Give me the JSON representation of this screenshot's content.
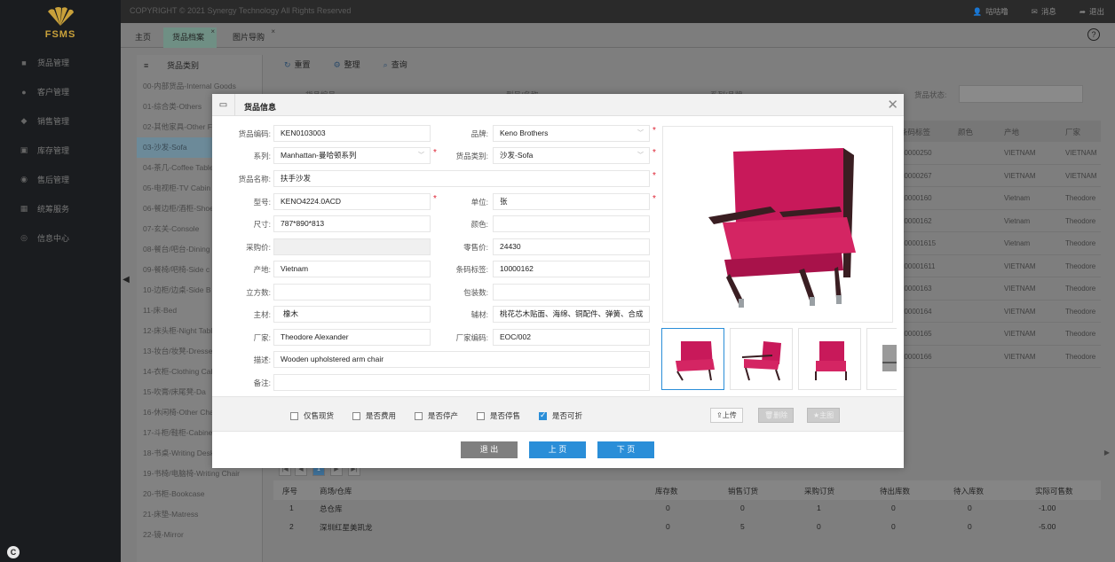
{
  "brand": {
    "logo_text": "FSMS"
  },
  "topbar": {
    "copyright": "COPYRIGHT © 2021 Synergy Technology All Rights Reserved",
    "user": "咕咕噜",
    "messages": "消息",
    "logout": "退出"
  },
  "sidebar": {
    "items": [
      {
        "label": "货品管理",
        "icon": "box-icon"
      },
      {
        "label": "客户管理",
        "icon": "users-icon"
      },
      {
        "label": "销售管理",
        "icon": "cart-icon"
      },
      {
        "label": "库存管理",
        "icon": "warehouse-icon"
      },
      {
        "label": "售后管理",
        "icon": "service-icon"
      },
      {
        "label": "统筹服务",
        "icon": "grid-icon"
      },
      {
        "label": "信息中心",
        "icon": "info-icon"
      }
    ],
    "footer_badge": "C"
  },
  "tabs": [
    {
      "label": "主页"
    },
    {
      "label": "货品档案"
    },
    {
      "label": "图片导购"
    }
  ],
  "category_panel": {
    "title": "货品类别",
    "items": [
      "00-内部货品-Internal Goods",
      "01-综合类-Others",
      "02-其他家具-Other F",
      "03-沙发-Sofa",
      "04-茶几-Coffee Table",
      "05-电视柜-TV Cabin",
      "06-餐边柜/酒柜-Shoe",
      "07-玄关-Console",
      "08-餐台/吧台-Dining",
      "09-餐椅/吧椅-Side c",
      "10-边柜/边桌-Side B",
      "11-床-Bed",
      "12-床头柜-Night Table",
      "13-妆台/妆凳-Dresse",
      "14-衣柜-Clothing Cab",
      "15-吹膏/床尾凳-Da",
      "16-休闲椅-Other Cha",
      "17-斗柜/鞋柜-Cabine",
      "18-书桌-Writing Desk",
      "19-书椅/电脑椅-Writing Chair",
      "20-书柜-Bookcase",
      "21-床垫-Matress",
      "22-镜-Mirror"
    ],
    "selected_index": 3
  },
  "toolbar": {
    "refresh": "重置",
    "organize": "整理",
    "query": "查询"
  },
  "filters": {
    "f1": "货品编号",
    "f2": "型号/名称",
    "f3": "系列/品牌",
    "status": "货品状态:"
  },
  "grid": {
    "headers": {
      "barcode": "条码标签",
      "color": "颜色",
      "origin": "产地",
      "maker": "厂家"
    },
    "rows": [
      {
        "barcode": "10000250",
        "origin": "VIETNAM",
        "maker": "VIETNAM"
      },
      {
        "barcode": "10000267",
        "origin": "VIETNAM",
        "maker": "VIETNAM"
      },
      {
        "barcode": "10000160",
        "origin": "Vietnam",
        "maker": "Theodore"
      },
      {
        "barcode": "10000162",
        "origin": "Vietnam",
        "maker": "Theodore"
      },
      {
        "barcode": "100001615",
        "origin": "Vietnam",
        "maker": "Theodore"
      },
      {
        "barcode": "100001611",
        "origin": "VIETNAM",
        "maker": "Theodore"
      },
      {
        "barcode": "10000163",
        "origin": "VIETNAM",
        "maker": "Theodore"
      },
      {
        "barcode": "10000164",
        "origin": "VIETNAM",
        "maker": "Theodore"
      },
      {
        "barcode": "10000165",
        "origin": "VIETNAM",
        "maker": "Theodore"
      },
      {
        "barcode": "10000166",
        "origin": "VIETNAM",
        "maker": "Theodore"
      }
    ]
  },
  "pager": {
    "current": "1"
  },
  "inventory": {
    "headers": {
      "no": "序号",
      "store": "商场/仓库",
      "stock": "库存数",
      "sales_order": "销售订货",
      "purchase_order": "采购订货",
      "shipping": "待出库数",
      "receiving": "待入库数",
      "available": "实际可售数"
    },
    "rows": [
      {
        "no": "1",
        "store": "总仓库",
        "stock": "0",
        "sales_order": "0",
        "purchase_order": "1",
        "shipping": "0",
        "receiving": "0",
        "available": "-1.00"
      },
      {
        "no": "2",
        "store": "深圳红星美凯龙",
        "stock": "0",
        "sales_order": "5",
        "purchase_order": "0",
        "shipping": "0",
        "receiving": "0",
        "available": "-5.00"
      }
    ]
  },
  "modal": {
    "title": "货品信息",
    "fields": {
      "code": {
        "label": "货品编码:",
        "value": "KEN0103003"
      },
      "brand": {
        "label": "品牌:",
        "value": "Keno Brothers"
      },
      "series": {
        "label": "系列:",
        "value": "Manhattan-曼哈顿系列"
      },
      "category": {
        "label": "货品类别:",
        "value": "沙发-Sofa"
      },
      "name": {
        "label": "货品名称:",
        "value": "扶手沙发"
      },
      "model": {
        "label": "型号:",
        "value": "KENO4224.0ACD"
      },
      "unit": {
        "label": "单位:",
        "value": "张"
      },
      "size": {
        "label": "尺寸:",
        "value": "787*890*813"
      },
      "color": {
        "label": "颜色:",
        "value": ""
      },
      "purchase_price": {
        "label": "采购价:",
        "value": ""
      },
      "retail_price": {
        "label": "零售价:",
        "value": "24430"
      },
      "origin": {
        "label": "产地:",
        "value": "Vietnam"
      },
      "barcode": {
        "label": "条码标签:",
        "value": "10000162"
      },
      "cubic": {
        "label": "立方数:",
        "value": ""
      },
      "packages": {
        "label": "包装数:",
        "value": ""
      },
      "main_material": {
        "label": "主材:",
        "value": "橡木"
      },
      "aux_material": {
        "label": "辅材:",
        "value": "桃花芯木贴面、海绵、铜配件、弹簧、合成"
      },
      "maker": {
        "label": "厂家:",
        "value": "Theodore Alexander"
      },
      "maker_code": {
        "label": "厂家编码:",
        "value": "EOC/002"
      },
      "desc": {
        "label": "描述:",
        "value": "Wooden upholstered arm chair"
      },
      "remark": {
        "label": "备注:",
        "value": ""
      }
    },
    "checkboxes": [
      {
        "label": "仅售现货",
        "checked": false
      },
      {
        "label": "是否费用",
        "checked": false
      },
      {
        "label": "是否停产",
        "checked": false
      },
      {
        "label": "是否停售",
        "checked": false
      },
      {
        "label": "是否可折",
        "checked": true
      }
    ],
    "image_buttons": {
      "upload": "上传",
      "delete": "删除",
      "primary": "主图"
    },
    "nav_buttons": {
      "exit": "退 出",
      "prev": "上 页",
      "next": "下 页"
    },
    "colors": {
      "accent": "#2a8ed8",
      "exit": "#7f7f7f",
      "chair": "#c8195a",
      "required": "#dd2233"
    }
  }
}
